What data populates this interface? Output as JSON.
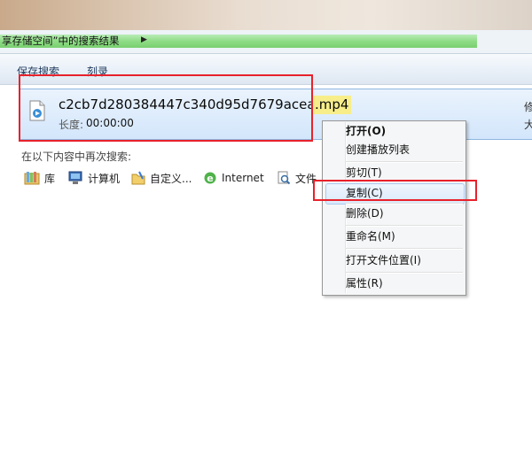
{
  "address": {
    "path_text": "享存储空间”中的搜索结果",
    "colors": {
      "progress": "#7fd477"
    }
  },
  "toolbar": {
    "save_search": "保存搜索",
    "burn": "刻录"
  },
  "result": {
    "file_name": "c2cb7d280384447c340d95d7679acea8",
    "extension": ".mp4",
    "duration_label": "长度:",
    "duration_value": "00:00:00",
    "right_partial_1": "修",
    "right_partial_2": "大"
  },
  "search_again": {
    "heading": "在以下内容中再次搜索:",
    "locations": [
      {
        "label": "库",
        "icon": "library-icon"
      },
      {
        "label": "计算机",
        "icon": "computer-icon"
      },
      {
        "label": "自定义...",
        "icon": "custom-folder-icon"
      },
      {
        "label": "Internet",
        "icon": "internet-explorer-icon"
      },
      {
        "label": "文件",
        "icon": "file-search-icon"
      }
    ]
  },
  "context_menu": {
    "items": [
      {
        "label": "打开(O)",
        "bold": true
      },
      {
        "label": "创建播放列表"
      },
      {
        "label": "剪切(T)"
      },
      {
        "label": "复制(C)",
        "highlighted": true
      },
      {
        "label": "删除(D)"
      },
      {
        "label": "重命名(M)"
      },
      {
        "label": "打开文件位置(I)"
      },
      {
        "label": "属性(R)"
      }
    ]
  },
  "annotation_color": "#e8212b"
}
